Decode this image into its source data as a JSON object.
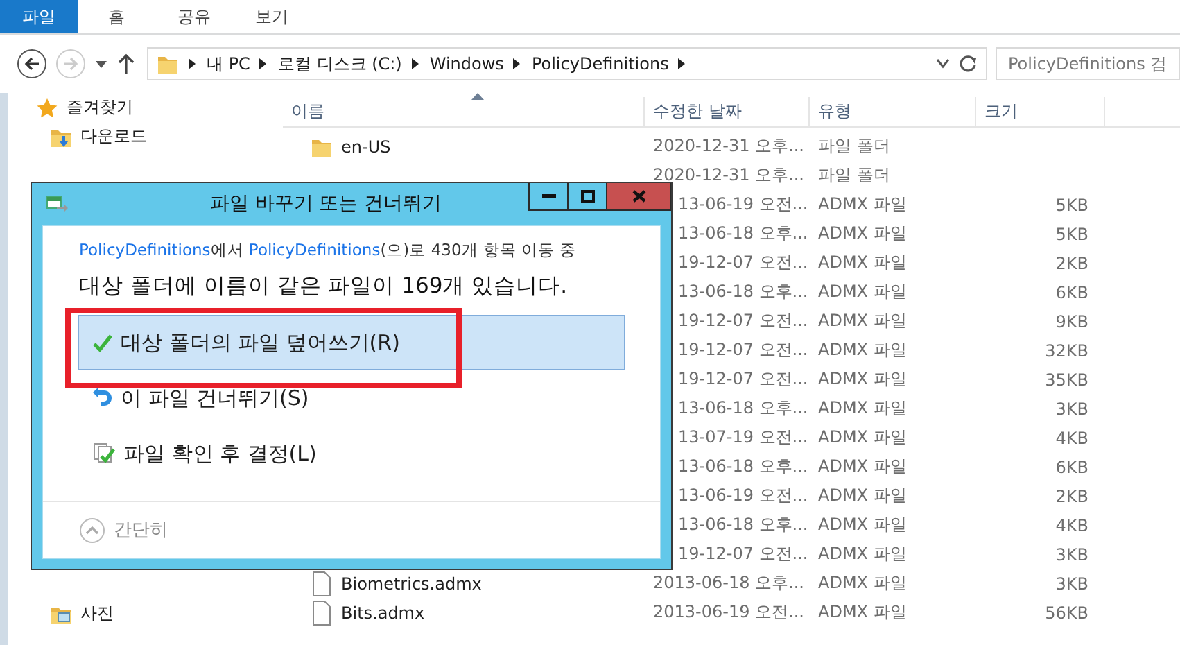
{
  "ribbon_tabs": [
    {
      "label": "파일",
      "selected": true
    },
    {
      "label": "홈",
      "selected": false
    },
    {
      "label": "공유",
      "selected": false
    },
    {
      "label": "보기",
      "selected": false
    }
  ],
  "address": {
    "crumbs": [
      "내 PC",
      "로컬 디스크 (C:)",
      "Windows",
      "PolicyDefinitions"
    ]
  },
  "search": {
    "placeholder": "PolicyDefinitions 검"
  },
  "sidebar": {
    "top": [
      {
        "label": "즐겨찾기",
        "kind": "star"
      },
      {
        "label": "다운로드",
        "kind": "download"
      }
    ],
    "bottom": [
      {
        "label": "사진",
        "kind": "pictures"
      }
    ]
  },
  "columns": [
    "이름",
    "수정한 날짜",
    "유형",
    "크기"
  ],
  "files": [
    {
      "name": "en-US",
      "kind": "folder",
      "modified": "2020-12-31 오후...",
      "type": "파일 폴더"
    },
    {
      "modified": "2020-12-31 오후...",
      "type": "파일 폴더"
    },
    {
      "modified": "13-06-19 오전...",
      "type": "ADMX 파일",
      "size": "5KB"
    },
    {
      "modified": "13-06-18 오후...",
      "type": "ADMX 파일",
      "size": "5KB"
    },
    {
      "modified": "19-12-07 오전...",
      "type": "ADMX 파일",
      "size": "2KB"
    },
    {
      "modified": "13-06-18 오후...",
      "type": "ADMX 파일",
      "size": "6KB"
    },
    {
      "modified": "19-12-07 오전...",
      "type": "ADMX 파일",
      "size": "9KB"
    },
    {
      "modified": "19-12-07 오전...",
      "type": "ADMX 파일",
      "size": "32KB"
    },
    {
      "modified": "19-12-07 오전...",
      "type": "ADMX 파일",
      "size": "35KB"
    },
    {
      "modified": "13-06-18 오후...",
      "type": "ADMX 파일",
      "size": "3KB"
    },
    {
      "modified": "13-07-19 오전...",
      "type": "ADMX 파일",
      "size": "4KB"
    },
    {
      "modified": "13-06-18 오후...",
      "type": "ADMX 파일",
      "size": "6KB"
    },
    {
      "modified": "13-06-19 오전...",
      "type": "ADMX 파일",
      "size": "2KB"
    },
    {
      "modified": "13-06-18 오후...",
      "type": "ADMX 파일",
      "size": "4KB"
    },
    {
      "modified": "19-12-07 오전...",
      "type": "ADMX 파일",
      "size": "3KB"
    },
    {
      "name": "Biometrics.admx",
      "kind": "file",
      "modified": "2013-06-18 오후...",
      "type": "ADMX 파일",
      "size": "3KB"
    },
    {
      "name": "Bits.admx",
      "kind": "file",
      "modified": "2013-06-19 오전...",
      "type": "ADMX 파일",
      "size": "56KB"
    }
  ],
  "dialog": {
    "title": "파일 바꾸기 또는 건너뛰기",
    "info_parts": [
      {
        "text": "PolicyDefinitions",
        "link": true
      },
      {
        "text": "에서 ",
        "link": false
      },
      {
        "text": "PolicyDefinitions",
        "link": true
      },
      {
        "text": "(으)로 430개 항목 이동 중",
        "link": false
      }
    ],
    "heading": "대상 폴더에 이름이 같은 파일이 169개 있습니다.",
    "options": [
      {
        "label": "대상 폴더의 파일 덮어쓰기(R)",
        "kind": "replace",
        "selected": true
      },
      {
        "label": "이 파일 건너뛰기(S)",
        "kind": "skip",
        "selected": false
      },
      {
        "label": "파일 확인 후 결정(L)",
        "kind": "compare",
        "selected": false
      }
    ],
    "footer": "간단히"
  }
}
